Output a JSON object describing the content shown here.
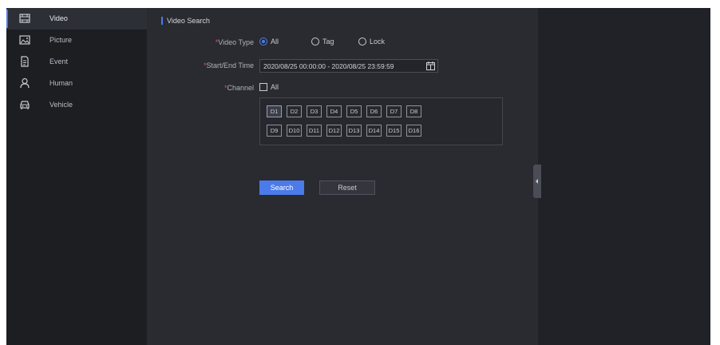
{
  "sidebar": {
    "items": [
      {
        "label": "Video",
        "icon": "video-icon",
        "active": true
      },
      {
        "label": "Picture",
        "icon": "picture-icon",
        "active": false
      },
      {
        "label": "Event",
        "icon": "event-icon",
        "active": false
      },
      {
        "label": "Human",
        "icon": "human-icon",
        "active": false
      },
      {
        "label": "Vehicle",
        "icon": "vehicle-icon",
        "active": false
      }
    ]
  },
  "main": {
    "section_title": "Video Search",
    "video_type": {
      "label": "Video Type",
      "options": [
        "All",
        "Tag",
        "Lock"
      ],
      "selected": "All"
    },
    "time": {
      "label": "Start/End Time",
      "value": "2020/08/25 00:00:00 - 2020/08/25 23:59:59"
    },
    "channel": {
      "label": "Channel",
      "all_label": "All",
      "all_checked": false,
      "channels": [
        "D1",
        "D2",
        "D3",
        "D4",
        "D5",
        "D6",
        "D7",
        "D8",
        "D9",
        "D10",
        "D11",
        "D12",
        "D13",
        "D14",
        "D15",
        "D16"
      ],
      "selected": [
        "D1"
      ]
    },
    "buttons": {
      "search": "Search",
      "reset": "Reset"
    },
    "required_mark": "*"
  },
  "colors": {
    "accent": "#4b7bea",
    "background": "#292b31",
    "sidebar": "#1c1e22",
    "required": "#d9534f"
  }
}
